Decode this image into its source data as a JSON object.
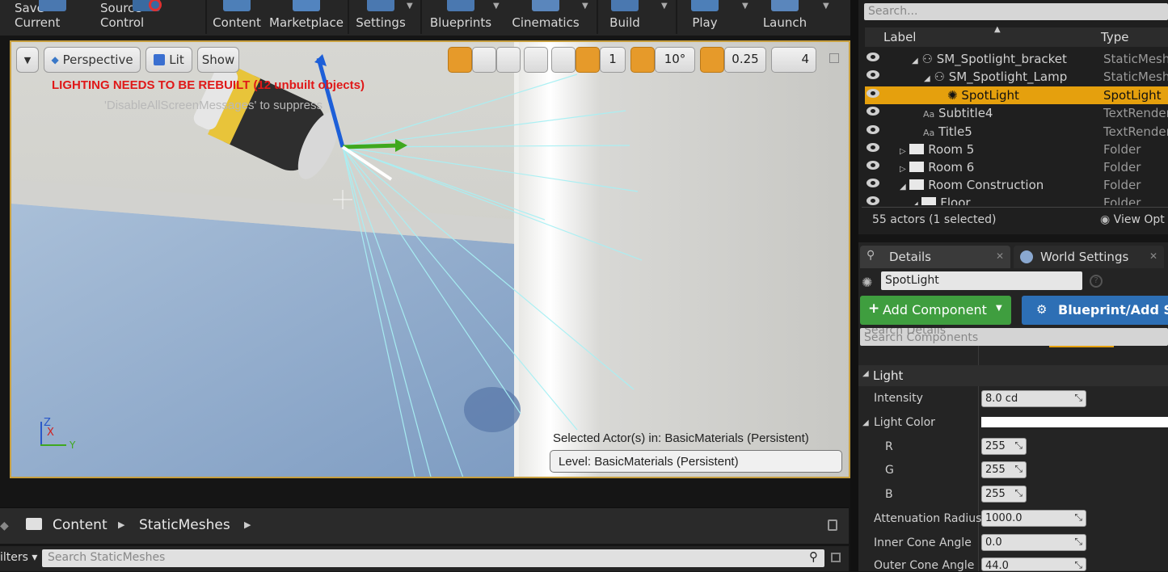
{
  "toolbar": {
    "buttons": [
      {
        "label": "Save Current"
      },
      {
        "label": "Source Control"
      },
      {
        "label": "Content"
      },
      {
        "label": "Marketplace"
      },
      {
        "label": "Settings"
      },
      {
        "label": "Blueprints"
      },
      {
        "label": "Cinematics"
      },
      {
        "label": "Build"
      },
      {
        "label": "Play"
      },
      {
        "label": "Launch"
      }
    ]
  },
  "viewport": {
    "view_mode": "Perspective",
    "lit": "Lit",
    "show": "Show",
    "grid_snap": "1",
    "rotation_snap": "10°",
    "scale_snap": "0.25",
    "camera_speed": "4",
    "warning": "LIGHTING NEEDS TO BE REBUILT (12 unbuilt objects)",
    "suppress_message": "'DisableAllScreenMessages' to suppress",
    "selected_actors_in": "Selected Actor(s) in:  BasicMaterials (Persistent)",
    "level": "Level:  BasicMaterials (Persistent)",
    "axis": {
      "z": "Z",
      "x": "X",
      "y": "Y"
    }
  },
  "content_browser": {
    "breadcrumb": [
      "Content",
      "StaticMeshes"
    ],
    "filters_label": "ilters",
    "search_placeholder": "Search StaticMeshes"
  },
  "outliner": {
    "search_placeholder": "Search...",
    "col_label": "Label",
    "col_type": "Type",
    "rows": [
      {
        "label": "SM_Spotlight_bracket",
        "type": "StaticMeshA"
      },
      {
        "label": "SM_Spotlight_Lamp",
        "type": "StaticMeshA"
      },
      {
        "label": "SpotLight",
        "type": "SpotLight"
      },
      {
        "label": "Subtitle4",
        "type": "TextRender"
      },
      {
        "label": "Title5",
        "type": "TextRender"
      },
      {
        "label": "Room 5",
        "type": "Folder"
      },
      {
        "label": "Room 6",
        "type": "Folder"
      },
      {
        "label": "Room Construction",
        "type": "Folder"
      },
      {
        "label": "Floor",
        "type": "Folder"
      }
    ],
    "actor_count": "55 actors (1 selected)",
    "view_options": "View Opt"
  },
  "details": {
    "tab_details": "Details",
    "tab_world": "World Settings",
    "actor_name": "SpotLight",
    "add_component": "Add Component",
    "blueprint_script": "Blueprint/Add Sc",
    "search_details": "Search Details",
    "search_components": "Search Components",
    "section_light": "Light",
    "props": {
      "intensity_label": "Intensity",
      "intensity_value": "8.0 cd",
      "light_color_label": "Light Color",
      "r_label": "R",
      "r_value": "255",
      "g_label": "G",
      "g_value": "255",
      "b_label": "B",
      "b_value": "255",
      "attenuation_label": "Attenuation Radius",
      "attenuation_value": "1000.0",
      "inner_cone_label": "Inner Cone Angle",
      "inner_cone_value": "0.0",
      "outer_cone_label": "Outer Cone Angle",
      "outer_cone_value": "44.0"
    }
  },
  "colors": {
    "selection": "#e5a00d",
    "warning": "#e01818",
    "add_component": "#3f9e3f",
    "blueprint": "#2d6fb5"
  }
}
